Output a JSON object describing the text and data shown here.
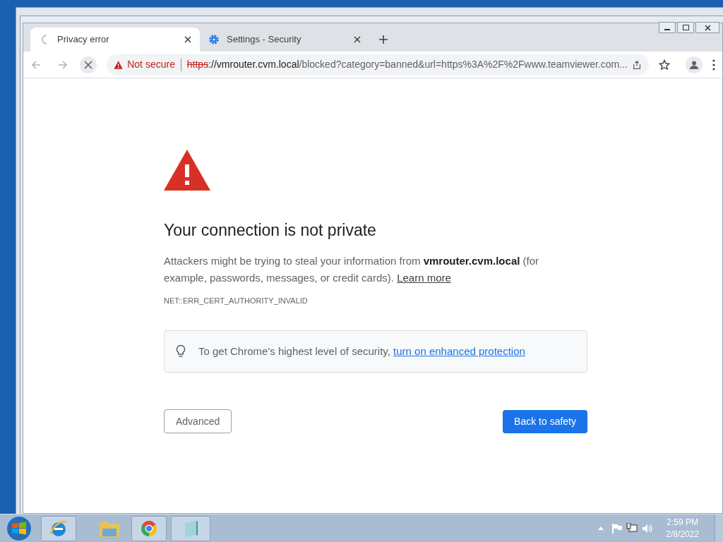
{
  "tabs": [
    {
      "title": "Privacy error",
      "kind": "loading",
      "selected": true
    },
    {
      "title": "Settings - Security",
      "kind": "settings",
      "selected": false
    }
  ],
  "address_bar": {
    "security_label": "Not secure",
    "scheme": "https",
    "host": "://vmrouter.cvm.local",
    "path": "/blocked?category=banned&url=https%3A%2F%2Fwww.teamviewer.com..."
  },
  "page": {
    "heading": "Your connection is not private",
    "message": "Attackers might be trying to steal your information from **vmrouter.cvm.local** (for example, passwords, messages, or credit cards).",
    "learn_more": "Learn more",
    "error_code": "NET::ERR_CERT_AUTHORITY_INVALID",
    "tip": "To get Chrome's highest level of security,",
    "tip_link": "turn on enhanced protection",
    "advanced_button": "Advanced",
    "back_button": "Back to safety"
  },
  "taskbar": {
    "time": "2:59 PM",
    "date": "2/8/2022"
  }
}
